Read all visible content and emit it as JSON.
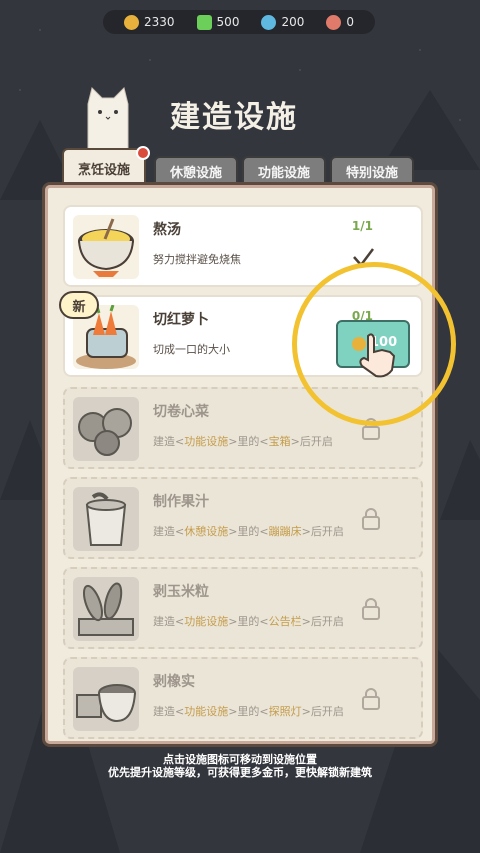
{
  "resources": [
    {
      "icon": "coin-icon",
      "value": "2330",
      "color": "#e8b13c"
    },
    {
      "icon": "lightning-icon",
      "value": "500",
      "color": "#6bcf5a"
    },
    {
      "icon": "gem-icon",
      "value": "200",
      "color": "#5fb8e0"
    },
    {
      "icon": "mushroom-icon",
      "value": "0",
      "color": "#e07a6a"
    }
  ],
  "title": "建造设施",
  "tabs": [
    {
      "label": "烹饪设施",
      "active": true,
      "badge": true
    },
    {
      "label": "休憩设施",
      "active": false
    },
    {
      "label": "功能设施",
      "active": false
    },
    {
      "label": "特别设施",
      "active": false
    }
  ],
  "facilities": [
    {
      "name": "熬汤",
      "desc": "努力搅拌避免烧焦",
      "count": "1/1",
      "state": "built"
    },
    {
      "name": "切红萝卜",
      "desc": "切成一口的大小",
      "count": "0/1",
      "state": "available",
      "badge": "新",
      "price": "100"
    },
    {
      "name": "切卷心菜",
      "desc_pre": "建造<",
      "req_cat": "功能设施",
      "desc_mid": ">里的<",
      "req_item": "宝箱",
      "desc_post": ">后开启",
      "state": "locked"
    },
    {
      "name": "制作果汁",
      "desc_pre": "建造<",
      "req_cat": "休憩设施",
      "desc_mid": ">里的<",
      "req_item": "蹦蹦床",
      "desc_post": ">后开启",
      "state": "locked"
    },
    {
      "name": "剥玉米粒",
      "desc_pre": "建造<",
      "req_cat": "功能设施",
      "desc_mid": ">里的<",
      "req_item": "公告栏",
      "desc_post": ">后开启",
      "state": "locked"
    },
    {
      "name": "剥橡实",
      "desc_pre": "建造<",
      "req_cat": "功能设施",
      "desc_mid": ">里的<",
      "req_item": "探照灯",
      "desc_post": ">后开启",
      "state": "locked"
    }
  ],
  "hint": {
    "line1": "点击设施图标可移动到设施位置",
    "line2": "优先提升设施等级，可获得更多金币，更快解锁新建筑"
  },
  "colors": {
    "ring": "#f2c230",
    "accent_green": "#7aa84d",
    "highlight": "#c49c4a"
  }
}
